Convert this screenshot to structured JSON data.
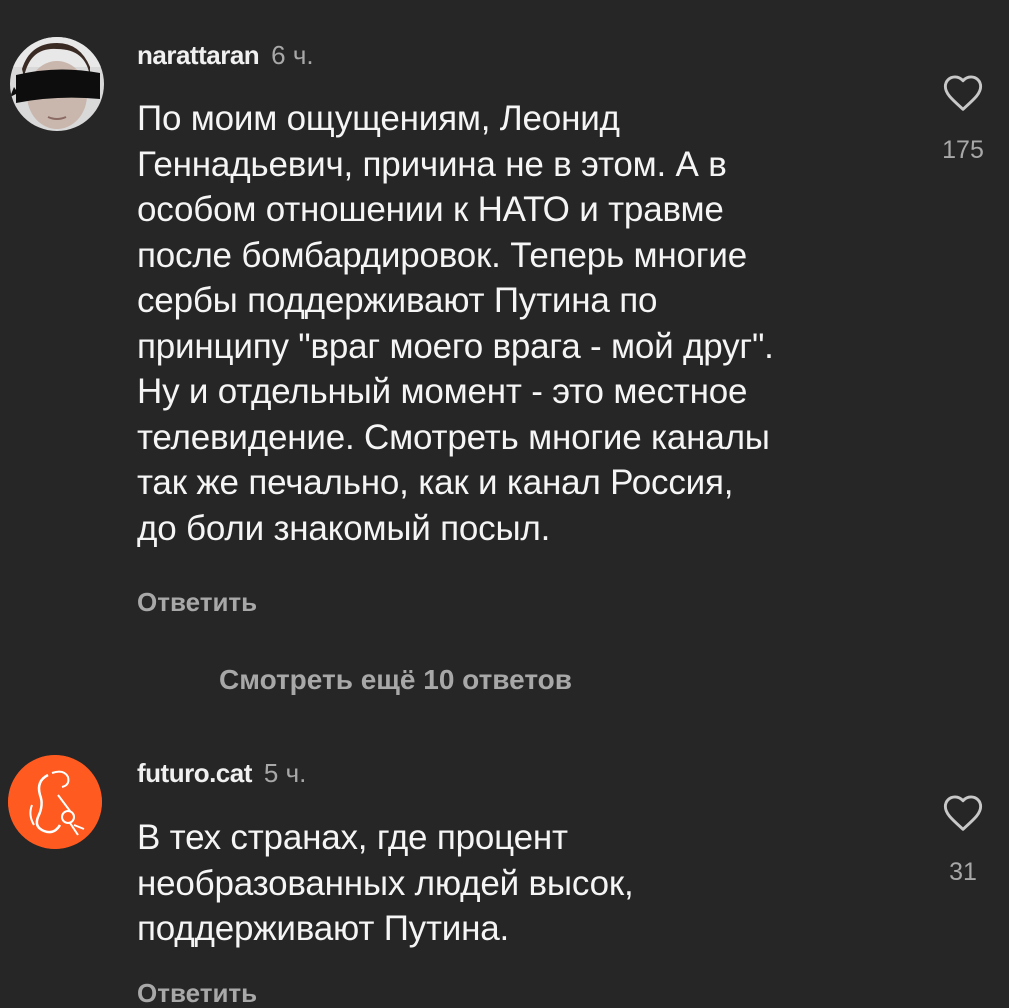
{
  "comments": [
    {
      "username": "narattaran",
      "time": "6 ч.",
      "lines": [
        "По моим ощущениям, Леонид",
        "Геннадьевич, причина не в этом. А в",
        "особом отношении к НАТО и травме",
        "после бомбардировок. Теперь многие",
        "сербы поддерживают Путина по",
        "принципу \"враг моего врага - мой друг\".",
        "Ну и отдельный момент - это местное",
        "телевидение. Смотреть многие каналы",
        "так же печально, как и канал Россия,",
        "до боли знакомый посыл."
      ],
      "reply_label": "Ответить",
      "like_icon": "heart-outline-icon",
      "like_count": "175"
    },
    {
      "username": "futuro.cat",
      "time": "5 ч.",
      "lines": [
        "В тех странах, где процент",
        "необразованных людей высок,",
        "поддерживают Путина."
      ],
      "reply_label": "Ответить",
      "like_icon": "heart-outline-icon",
      "like_count": "31",
      "avatar_color": "#ff5a1f"
    }
  ],
  "view_more_label": "Смотреть ещё 10 ответов",
  "colors": {
    "background": "#262626",
    "secondary_text": "#a8a8a8",
    "primary_text": "#f5f5f5"
  }
}
